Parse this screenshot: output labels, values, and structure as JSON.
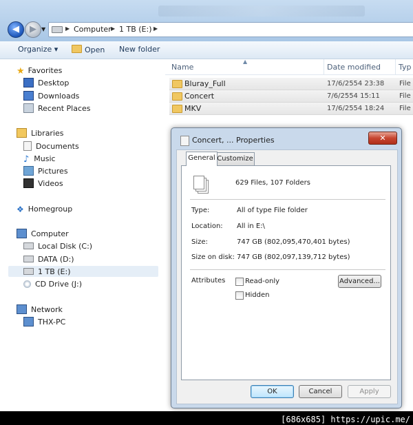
{
  "address": {
    "crumbs": [
      "Computer",
      "1 TB  (E:)"
    ]
  },
  "toolbar": {
    "organize": "Organize ▾",
    "open": "Open",
    "new_folder": "New folder"
  },
  "navpane": {
    "favorites": "Favorites",
    "desktop": "Desktop",
    "downloads": "Downloads",
    "recent": "Recent Places",
    "libraries": "Libraries",
    "documents": "Documents",
    "music": "Music",
    "pictures": "Pictures",
    "videos": "Videos",
    "homegroup": "Homegroup",
    "computer": "Computer",
    "local_disk": "Local Disk (C:)",
    "data": "DATA (D:)",
    "tb": "1 TB  (E:)",
    "cd": "CD Drive (J:)",
    "network": "Network",
    "thx": "THX-PC"
  },
  "columns": {
    "name": "Name",
    "date": "Date modified",
    "type": "Typ"
  },
  "files": [
    {
      "name": "Bluray_Full",
      "date": "17/6/2554 23:38",
      "type": "File"
    },
    {
      "name": "Concert",
      "date": "7/6/2554 15:11",
      "type": "File"
    },
    {
      "name": "MKV",
      "date": "17/6/2554 18:24",
      "type": "File"
    }
  ],
  "dialog": {
    "title": "Concert, ... Properties",
    "close": "✕",
    "tab_general": "General",
    "tab_customize": "Customize",
    "summary": "629 Files, 107 Folders",
    "type_label": "Type:",
    "type_value": "All of type File folder",
    "location_label": "Location:",
    "location_value": "All in E:\\",
    "size_label": "Size:",
    "size_value": "747 GB (802,095,470,401 bytes)",
    "size_disk_label": "Size on disk:",
    "size_disk_value": "747 GB (802,097,139,712 bytes)",
    "attributes_label": "Attributes",
    "readonly": "Read-only",
    "hidden": "Hidden",
    "advanced": "Advanced...",
    "ok": "OK",
    "cancel": "Cancel",
    "apply": "Apply"
  },
  "watermark": "[686x685] https://upic.me/"
}
